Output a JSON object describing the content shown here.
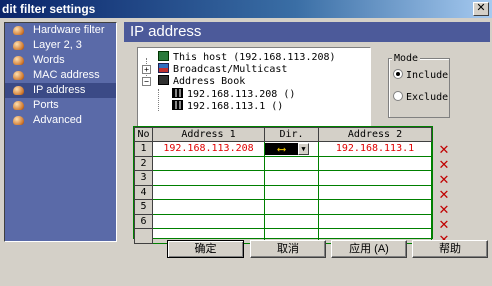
{
  "window": {
    "title": "dit filter settings",
    "close_label": "✕"
  },
  "sidebar": {
    "items": [
      {
        "label": "Hardware filter",
        "active": false
      },
      {
        "label": "Layer 2, 3",
        "active": false
      },
      {
        "label": "Words",
        "active": false
      },
      {
        "label": "MAC address",
        "active": false
      },
      {
        "label": "IP address",
        "active": true
      },
      {
        "label": "Ports",
        "active": false
      },
      {
        "label": "Advanced",
        "active": false
      }
    ]
  },
  "main": {
    "header": "IP address",
    "tree": [
      {
        "label": "This host (192.168.113.208)",
        "icon": "computer-icon"
      },
      {
        "label": "Broadcast/Multicast",
        "icon": "network-icon"
      },
      {
        "label": "Address Book",
        "icon": "address-book-icon"
      },
      {
        "label": "192.168.113.208 ()",
        "icon": "address-icon"
      },
      {
        "label": "192.168.113.1 ()",
        "icon": "address-icon"
      }
    ],
    "mode": {
      "legend": "Mode",
      "options": [
        {
          "label": "Include",
          "selected": true
        },
        {
          "label": "Exclude",
          "selected": false
        }
      ]
    },
    "table": {
      "headers": [
        "No",
        "Address 1",
        "Dir.",
        "Address 2"
      ],
      "rows": [
        {
          "no": "1",
          "address1": "192.168.113.208",
          "dir": "⟷",
          "address2": "192.168.113.1"
        },
        {
          "no": "2",
          "address1": "",
          "dir": "",
          "address2": ""
        },
        {
          "no": "3",
          "address1": "",
          "dir": "",
          "address2": ""
        },
        {
          "no": "4",
          "address1": "",
          "dir": "",
          "address2": ""
        },
        {
          "no": "5",
          "address1": "",
          "dir": "",
          "address2": ""
        },
        {
          "no": "6",
          "address1": "",
          "dir": "",
          "address2": ""
        },
        {
          "no": "",
          "address1": "",
          "dir": "",
          "address2": ""
        }
      ],
      "delete_mark": "✕"
    }
  },
  "buttons": {
    "ok": "确定",
    "cancel": "取消",
    "apply": "应用 (A)",
    "help": "帮助"
  },
  "colors": {
    "sidebar_bg": "#5a6aa8",
    "header_bg": "#4c5a9a",
    "address_text": "#e00000",
    "delete_mark": "#c00000"
  }
}
